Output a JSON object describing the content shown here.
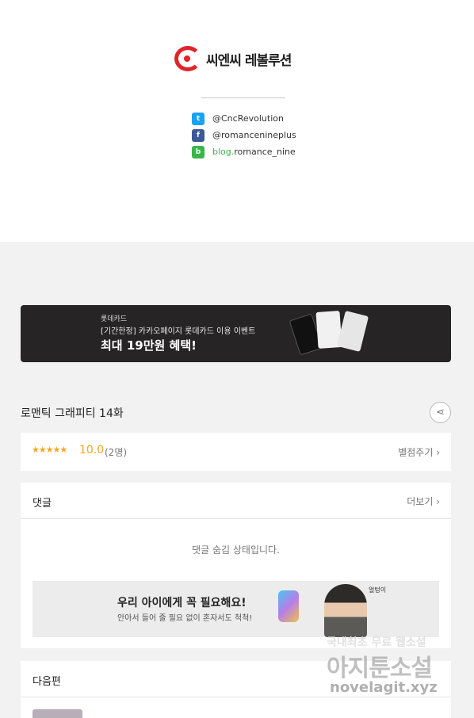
{
  "brand": {
    "logo_text": "씨엔씨 레볼루션"
  },
  "social": [
    {
      "icon": "twitter-icon",
      "prefix": "",
      "text": "@CncRevolution"
    },
    {
      "icon": "facebook-icon",
      "prefix": "",
      "text": "@romancenineplus"
    },
    {
      "icon": "blog-icon",
      "prefix": "blog.",
      "text": "romance_nine"
    }
  ],
  "banner": {
    "brand": "롯데카드",
    "subtitle": "[기간한정] 카카오페이지 롯데카드 이용 이벤트",
    "headline": "최대 19만원 혜택!"
  },
  "episode": {
    "title": "로맨틱 그래피티 14화"
  },
  "rating": {
    "stars": "★★★★★",
    "score": "10.0",
    "count": "(2명)",
    "rate_link": "별점주기 ›"
  },
  "comments": {
    "title": "댓글",
    "more": "더보기 ›",
    "hidden_notice": "댓글 숨김 상태입니다.",
    "ad": {
      "headline": "우리 아이에게 꼭 필요해요!",
      "subtext": "안아서 들어 줄 필요 없이 혼자서도 척척!",
      "tag": "얼텅이"
    }
  },
  "next": {
    "title": "다음편"
  },
  "watermark": {
    "line1": "국내최초 무료 웹소설",
    "line2": "아지툰소설",
    "line3": "novelagit.xyz"
  },
  "colors": {
    "brand_red": "#e0242b",
    "star": "#f5a623",
    "blog_green": "#3ab54a",
    "twitter": "#1da1f2",
    "facebook": "#3b5998"
  }
}
